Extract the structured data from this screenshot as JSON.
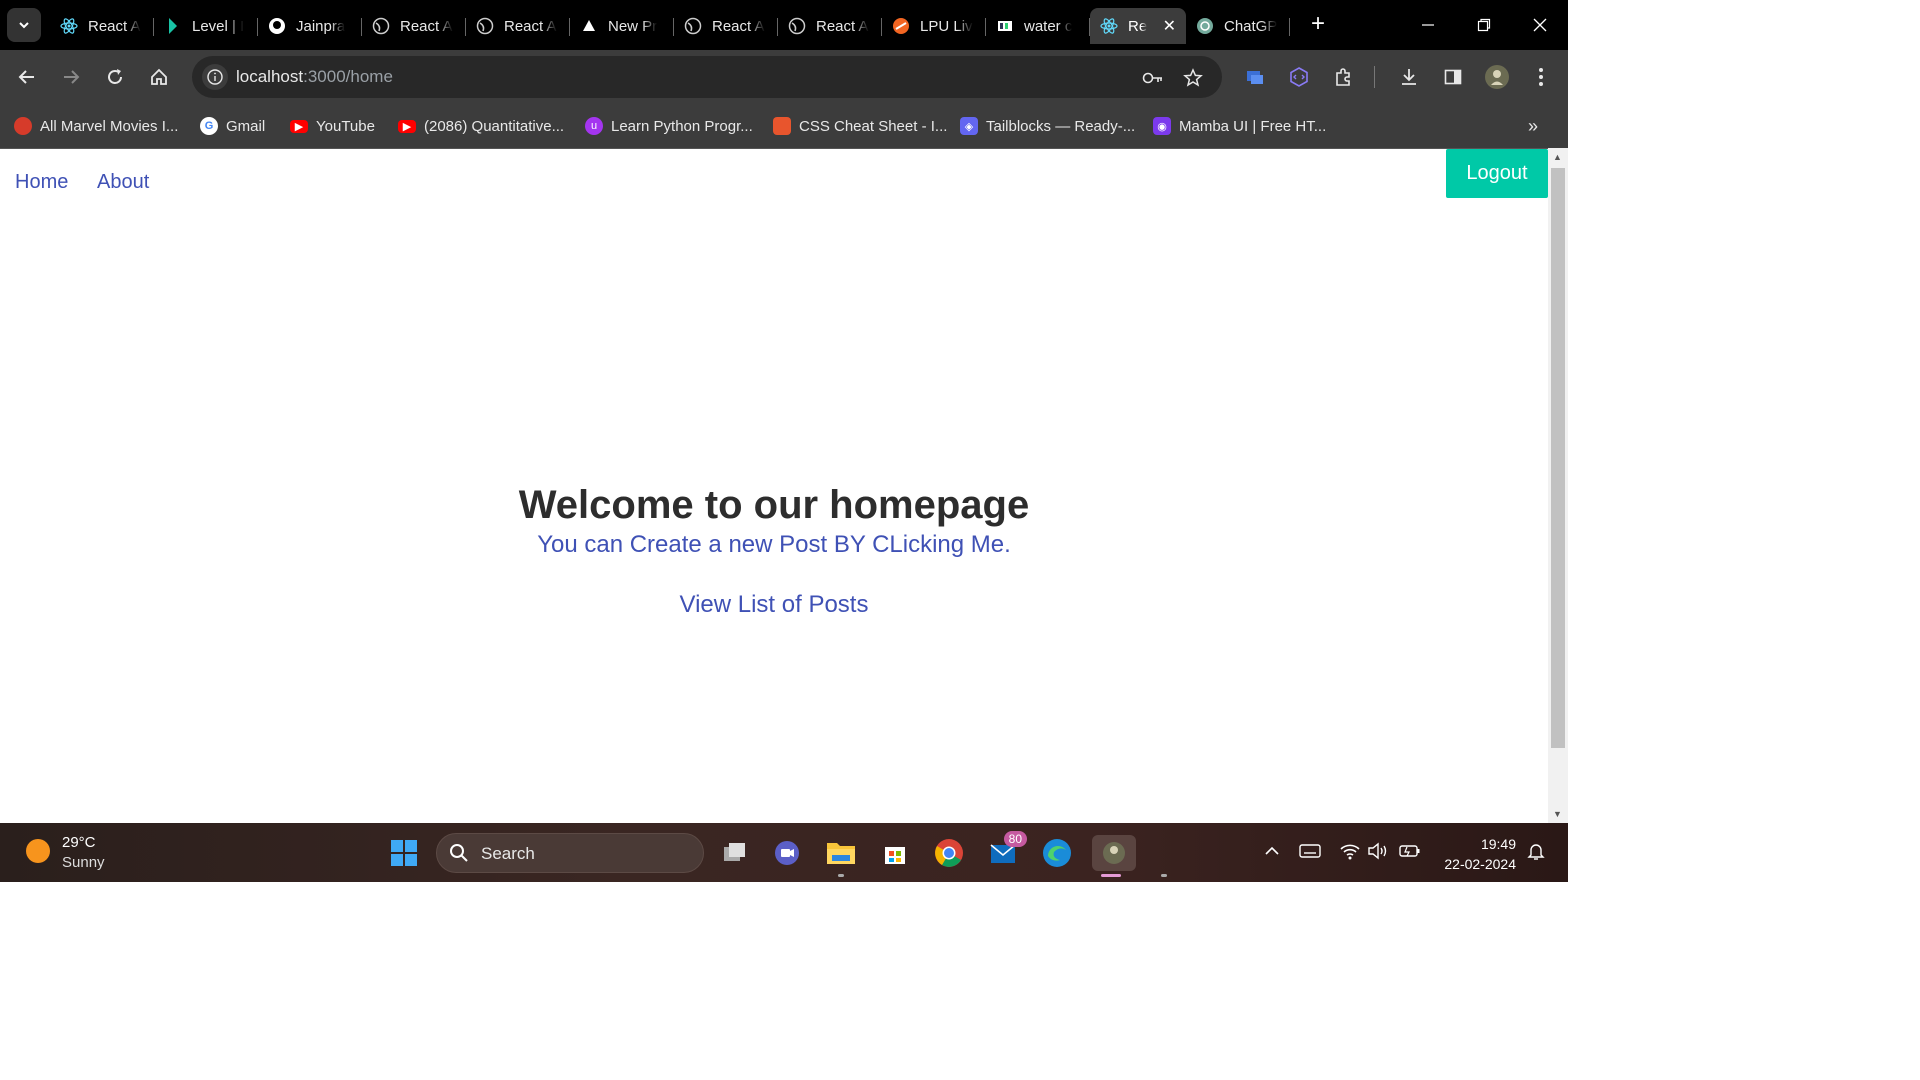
{
  "tabs": [
    {
      "title": "React A",
      "icon": "react-icon"
    },
    {
      "title": "Level | I",
      "icon": "level-icon"
    },
    {
      "title": "Jainpra",
      "icon": "github-icon"
    },
    {
      "title": "React A",
      "icon": "globe-icon"
    },
    {
      "title": "React A",
      "icon": "globe-icon"
    },
    {
      "title": "New Pr",
      "icon": "vercel-icon"
    },
    {
      "title": "React A",
      "icon": "globe-icon"
    },
    {
      "title": "React A",
      "icon": "globe-icon"
    },
    {
      "title": "LPU Liv",
      "icon": "lpu-icon"
    },
    {
      "title": "water c",
      "icon": "hackerearth-icon"
    },
    {
      "title": "Re",
      "icon": "react-icon",
      "active": true
    },
    {
      "title": "ChatGP",
      "icon": "chatgpt-icon"
    }
  ],
  "address": {
    "host": "localhost",
    "path": ":3000/home"
  },
  "bookmarks": [
    {
      "label": "All Marvel Movies I...",
      "icon": "tomato-icon",
      "color": "#d63b2a"
    },
    {
      "label": "Gmail",
      "icon": "google-icon",
      "color": "#ffffff"
    },
    {
      "label": "YouTube",
      "icon": "youtube-icon",
      "color": "#ff0000"
    },
    {
      "label": "(2086) Quantitative...",
      "icon": "youtube-icon",
      "color": "#ff0000"
    },
    {
      "label": "Learn Python Progr...",
      "icon": "udemy-icon",
      "color": "#a435f0"
    },
    {
      "label": "CSS Cheat Sheet - I...",
      "icon": "css-icon",
      "color": "#e8552d"
    },
    {
      "label": "Tailblocks — Ready-...",
      "icon": "tailblocks-icon",
      "color": "#6366f1"
    },
    {
      "label": "Mamba UI | Free HT...",
      "icon": "mamba-icon",
      "color": "#7c3aed"
    }
  ],
  "nav": {
    "home": "Home",
    "about": "About"
  },
  "logout": "Logout",
  "hero": {
    "title": "Welcome to our homepage",
    "create_link": "You can Create a new Post BY CLicking Me.",
    "view_link": "View List of Posts"
  },
  "taskbar": {
    "temp": "29°C",
    "condition": "Sunny",
    "search_placeholder": "Search",
    "mail_badge": "80",
    "time": "19:49",
    "date": "22-02-2024"
  },
  "colors": {
    "accent": "#00c9a7",
    "link": "#3f51b5"
  }
}
